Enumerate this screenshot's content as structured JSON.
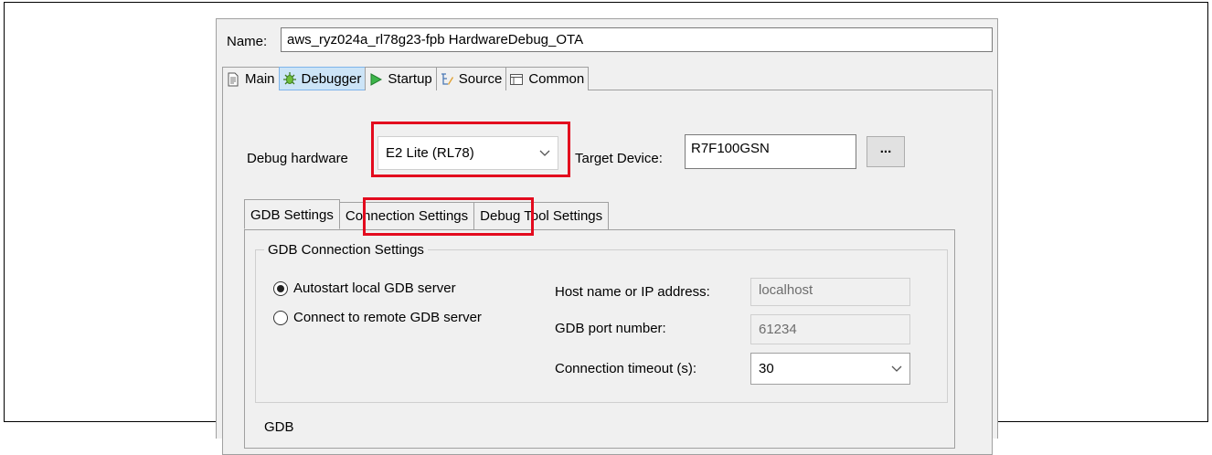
{
  "name_field": {
    "label": "Name:",
    "value": "aws_ryz024a_rl78g23-fpb HardwareDebug_OTA"
  },
  "tabs": [
    {
      "label": "Main",
      "icon": "document-icon"
    },
    {
      "label": "Debugger",
      "icon": "bug-icon",
      "active": true
    },
    {
      "label": "Startup",
      "icon": "play-icon"
    },
    {
      "label": "Source",
      "icon": "source-icon"
    },
    {
      "label": "Common",
      "icon": "common-icon"
    }
  ],
  "debug_hardware": {
    "label": "Debug hardware",
    "value": "E2 Lite (RL78)"
  },
  "target_device": {
    "label": "Target Device:",
    "value": "R7F100GSN",
    "browse_label": "..."
  },
  "subtabs": [
    {
      "label": "GDB Settings",
      "active": true
    },
    {
      "label": "Connection Settings"
    },
    {
      "label": "Debug Tool Settings"
    }
  ],
  "gdb_connection": {
    "title": "GDB Connection Settings",
    "radio_autostart": "Autostart local GDB server",
    "radio_remote": "Connect to remote GDB server",
    "host_label": "Host name or IP address:",
    "host_value": "localhost",
    "port_label": "GDB port number:",
    "port_value": "61234",
    "timeout_label": "Connection timeout (s):",
    "timeout_value": "30"
  },
  "next_group_title": "GDB",
  "highlight_color": "#e30b1e"
}
